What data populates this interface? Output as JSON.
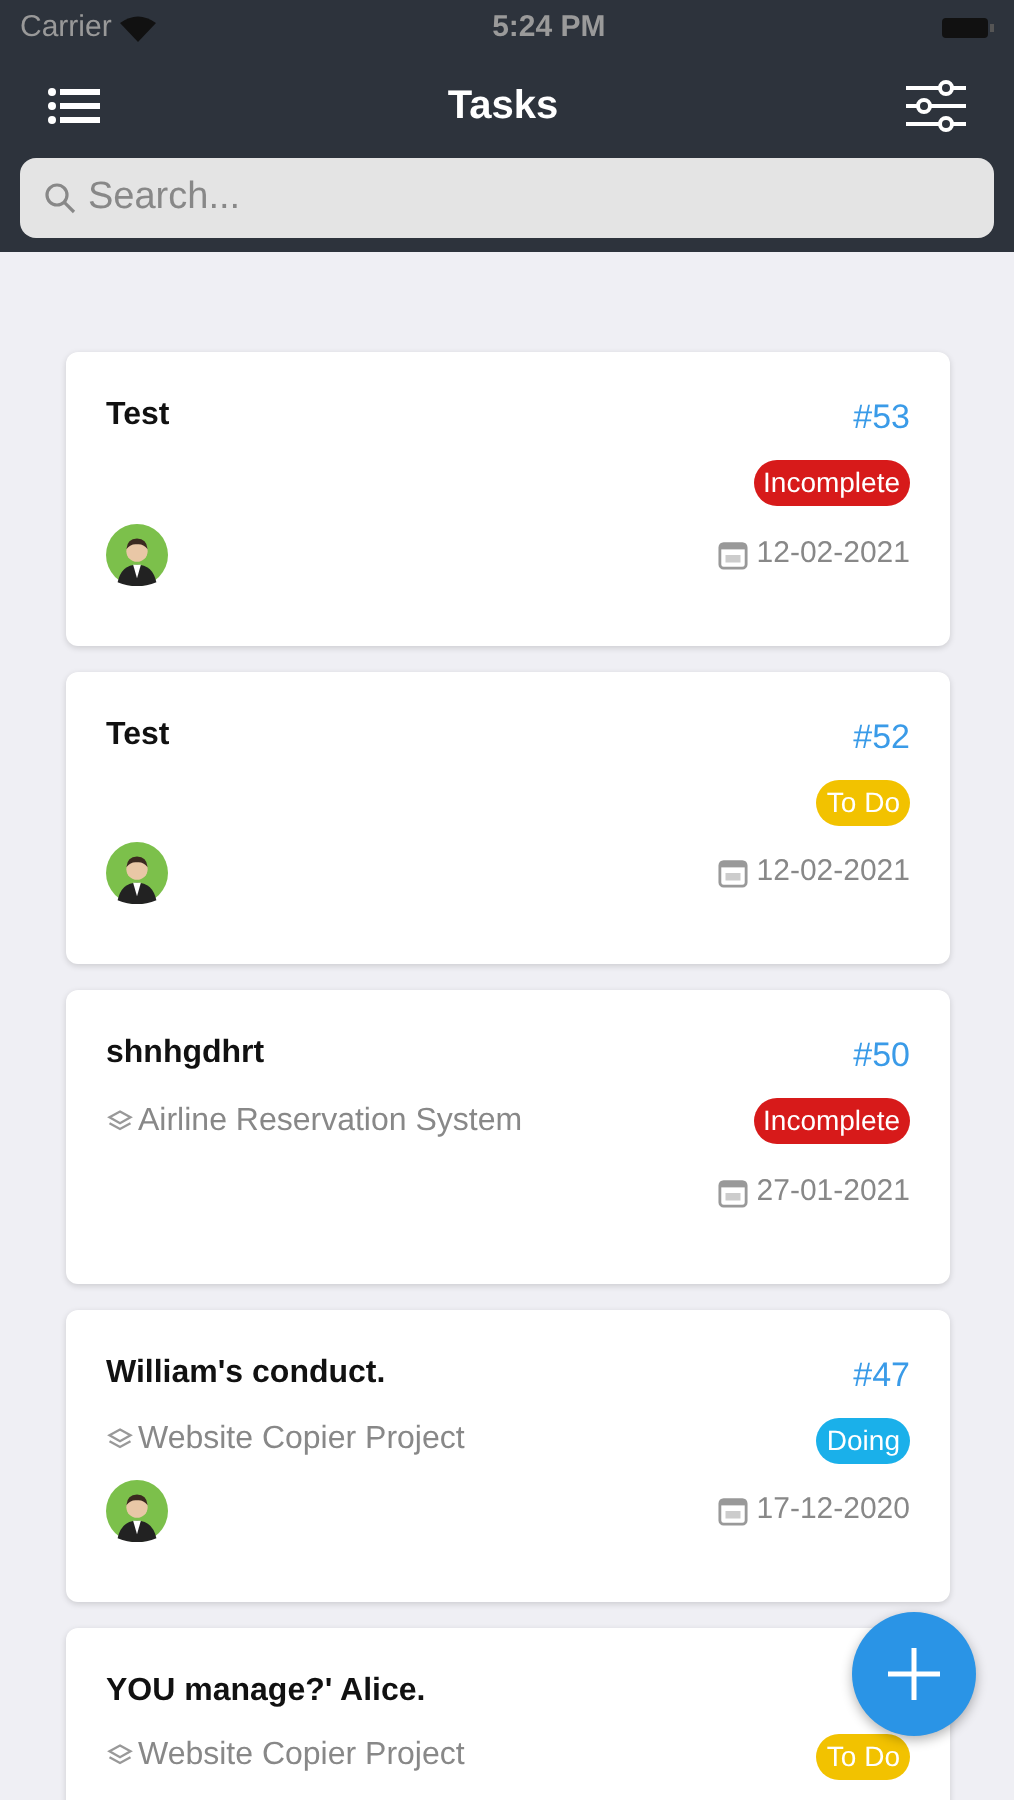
{
  "status_bar": {
    "carrier": "Carrier",
    "time": "5:24 PM"
  },
  "nav": {
    "title": "Tasks"
  },
  "search": {
    "placeholder": "Search..."
  },
  "tasks": [
    {
      "title": "Test",
      "number": "#53",
      "status": "Incomplete",
      "color": "#d71a1a",
      "date": "12-02-2021",
      "avatar": true
    },
    {
      "title": "Test",
      "number": "#52",
      "status": "To Do",
      "color": "#f2c200",
      "date": "12-02-2021",
      "avatar": true
    },
    {
      "title": "shnhgdhrt",
      "number": "#50",
      "project": "Airline Reservation System",
      "status": "Incomplete",
      "color": "#d71a1a",
      "date": "27-01-2021",
      "avatar": false
    },
    {
      "title": "William's conduct.",
      "number": "#47",
      "project": "Website Copier Project",
      "status": "Doing",
      "color": "#1ab0ea",
      "date": "17-12-2020",
      "avatar": true
    },
    {
      "title": "YOU manage?' Alice.",
      "project": "Website Copier Project",
      "status": "To Do",
      "color": "#f2c200",
      "avatar": false
    }
  ]
}
